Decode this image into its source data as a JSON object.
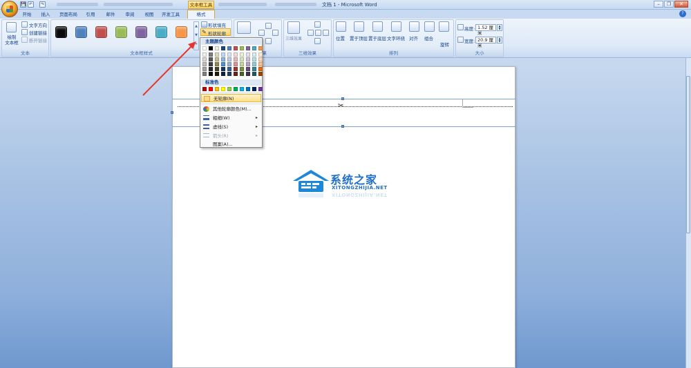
{
  "window": {
    "title": "文档 1 - Microsoft Word",
    "context_tab": "文本框工具",
    "minimize": "–",
    "restore": "❐",
    "close": "✕"
  },
  "qat": {
    "save": "💾",
    "undo": "↶",
    "redo": "↷"
  },
  "tabs": [
    "开始",
    "插入",
    "页面布局",
    "引用",
    "邮件",
    "审阅",
    "视图",
    "开发工具"
  ],
  "active_tab": "格式",
  "help": "?",
  "ribbon": {
    "text_group": {
      "label": "文本",
      "draw_textbox": "绘制\n文本框",
      "items": [
        "文字方向",
        "创建链接",
        "断开链接"
      ]
    },
    "styles_group": {
      "label": "文本框样式",
      "swatches": [
        "#0a0a0a",
        "#4f81bd",
        "#c0504d",
        "#9bbb59",
        "#8064a2",
        "#4bacc6",
        "#f79646"
      ],
      "shape_fill": "形状填充",
      "shape_outline": "形状轮廓"
    },
    "shadow_group": {
      "label": "阴影效果"
    },
    "three_d_group": {
      "label": "三维效果",
      "button": "三维效果"
    },
    "arrange_group": {
      "label": "排列",
      "items": [
        "位置",
        "置于顶层",
        "置于底层",
        "文字环绕",
        "对齐",
        "组合",
        "旋转"
      ]
    },
    "size_group": {
      "label": "大小",
      "height_label": "高度:",
      "height_value": "1.52 厘米",
      "width_label": "宽度:",
      "width_value": "20.9 厘米"
    }
  },
  "dropdown": {
    "theme_colors_title": "主题颜色",
    "standard_colors_title": "标准色",
    "theme_top": [
      "#ffffff",
      "#000000",
      "#eeece1",
      "#1f497d",
      "#4f81bd",
      "#c0504d",
      "#9bbb59",
      "#8064a2",
      "#4bacc6",
      "#f79646"
    ],
    "theme_shades": [
      [
        "#f2f2f2",
        "#7f7f7f",
        "#ddd9c3",
        "#c6d9f0",
        "#dbe5f1",
        "#f2dcdb",
        "#ebf1dd",
        "#e5e0ec",
        "#dbeef3",
        "#fdeada"
      ],
      [
        "#d8d8d8",
        "#595959",
        "#c4bd97",
        "#8db3e2",
        "#b8cce4",
        "#e5b9b7",
        "#d7e3bc",
        "#ccc1d9",
        "#b7dde8",
        "#fbd5b5"
      ],
      [
        "#bfbfbf",
        "#3f3f3f",
        "#938953",
        "#548dd4",
        "#95b3d7",
        "#d99694",
        "#c3d69b",
        "#b2a2c7",
        "#92cddc",
        "#fac08f"
      ],
      [
        "#a5a5a5",
        "#262626",
        "#494429",
        "#17365d",
        "#366092",
        "#953734",
        "#76923c",
        "#5f497a",
        "#31859b",
        "#e36c09"
      ],
      [
        "#7f7f7f",
        "#0c0c0c",
        "#1d1b10",
        "#0f243e",
        "#244061",
        "#632423",
        "#4f6128",
        "#3f3151",
        "#205867",
        "#974806"
      ]
    ],
    "standard": [
      "#c00000",
      "#ff0000",
      "#ffc000",
      "#ffff00",
      "#92d050",
      "#00b050",
      "#00b0f0",
      "#0070c0",
      "#002060",
      "#7030a0"
    ],
    "items": [
      {
        "label": "无轮廓(N)",
        "enabled": true,
        "submenu": false
      },
      {
        "label": "其他轮廓颜色(M)...",
        "enabled": true,
        "submenu": false
      },
      {
        "label": "粗细(W)",
        "enabled": true,
        "submenu": true
      },
      {
        "label": "虚线(S)",
        "enabled": true,
        "submenu": true
      },
      {
        "label": "箭头(R)",
        "enabled": false,
        "submenu": true
      },
      {
        "label": "图案(A)...",
        "enabled": true,
        "submenu": false
      }
    ]
  },
  "watermark": {
    "cn": "系统之家",
    "en": "XITONGZHIJIA.NET"
  },
  "colors": {
    "accent": "#d9a63a",
    "arrow": "#e8352b",
    "logo_blue": "#1e88d8"
  }
}
